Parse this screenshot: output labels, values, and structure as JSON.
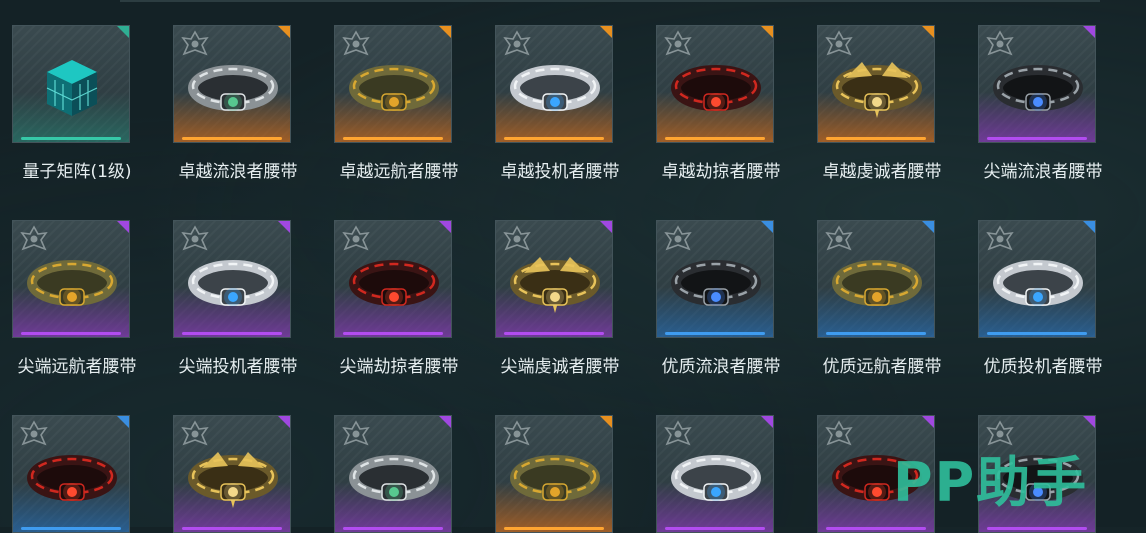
{
  "items": [
    {
      "name": "量子矩阵(1级)",
      "rarity": "teal",
      "art": "cube"
    },
    {
      "name": "卓越流浪者腰带",
      "rarity": "orange",
      "art": "belt-silver"
    },
    {
      "name": "卓越远航者腰带",
      "rarity": "orange",
      "art": "belt-olive"
    },
    {
      "name": "卓越投机者腰带",
      "rarity": "orange",
      "art": "belt-white-blue"
    },
    {
      "name": "卓越劫掠者腰带",
      "rarity": "orange",
      "art": "belt-red"
    },
    {
      "name": "卓越虔诚者腰带",
      "rarity": "orange",
      "art": "belt-gold-wing"
    },
    {
      "name": "尖端流浪者腰带",
      "rarity": "purple",
      "art": "belt-black"
    },
    {
      "name": "尖端远航者腰带",
      "rarity": "purple",
      "art": "belt-olive"
    },
    {
      "name": "尖端投机者腰带",
      "rarity": "purple",
      "art": "belt-white-blue"
    },
    {
      "name": "尖端劫掠者腰带",
      "rarity": "purple",
      "art": "belt-red"
    },
    {
      "name": "尖端虔诚者腰带",
      "rarity": "purple",
      "art": "belt-gold-wing"
    },
    {
      "name": "优质流浪者腰带",
      "rarity": "blue",
      "art": "belt-black"
    },
    {
      "name": "优质远航者腰带",
      "rarity": "blue",
      "art": "belt-olive"
    },
    {
      "name": "优质投机者腰带",
      "rarity": "blue",
      "art": "belt-white-blue"
    },
    {
      "name": "",
      "rarity": "blue",
      "art": "belt-red"
    },
    {
      "name": "",
      "rarity": "purple",
      "art": "belt-gold-wing"
    },
    {
      "name": "",
      "rarity": "purple",
      "art": "belt-silver"
    },
    {
      "name": "",
      "rarity": "orange",
      "art": "belt-olive"
    },
    {
      "name": "",
      "rarity": "purple",
      "art": "belt-white-blue"
    },
    {
      "name": "",
      "rarity": "purple",
      "art": "belt-red"
    },
    {
      "name": "",
      "rarity": "purple",
      "art": "belt-black"
    }
  ],
  "rarity_colors": {
    "teal": "#36c8a8",
    "orange": "#ffa531",
    "purple": "#b24cf0",
    "blue": "#3f9cf0"
  },
  "watermark": "PP助手"
}
